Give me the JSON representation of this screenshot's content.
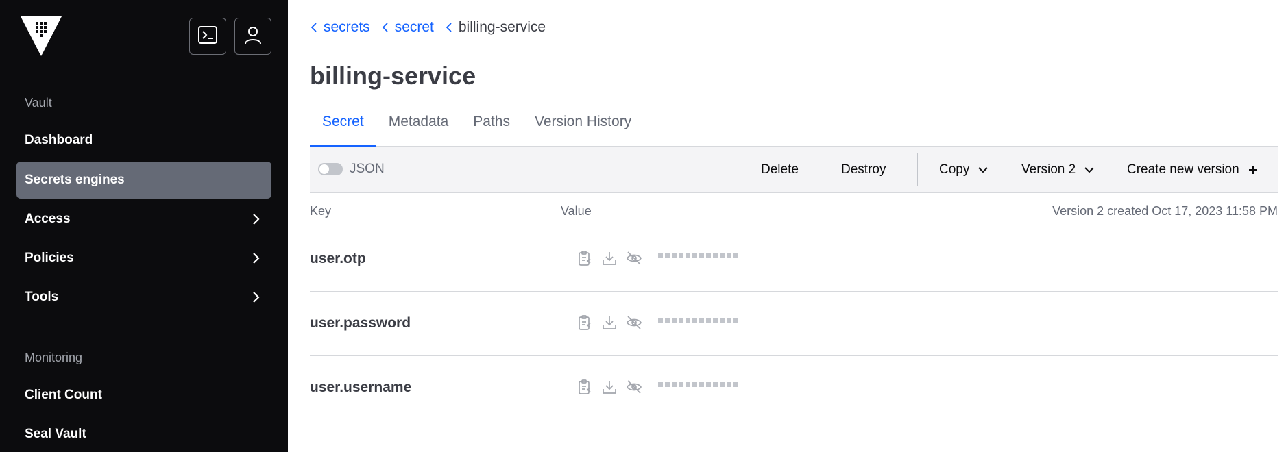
{
  "sidebar": {
    "logo_icon": "vault-logo-icon",
    "console_icon": "terminal-icon",
    "user_icon": "user-icon",
    "vault_heading": "Vault",
    "items": [
      {
        "label": "Dashboard"
      },
      {
        "label": "Secrets engines",
        "active": true
      },
      {
        "label": "Access"
      },
      {
        "label": "Policies"
      },
      {
        "label": "Tools"
      }
    ],
    "monitoring_heading": "Monitoring",
    "monitoring_items": [
      {
        "label": "Client Count"
      },
      {
        "label": "Seal Vault"
      }
    ]
  },
  "breadcrumb": {
    "items": [
      "secrets",
      "secret",
      "billing-service"
    ]
  },
  "page": {
    "title": "billing-service"
  },
  "tabs": [
    {
      "label": "Secret",
      "active": true
    },
    {
      "label": "Metadata"
    },
    {
      "label": "Paths"
    },
    {
      "label": "Version History"
    }
  ],
  "toolbar": {
    "json_label": "JSON",
    "delete_label": "Delete",
    "destroy_label": "Destroy",
    "copy_label": "Copy",
    "version_label": "Version 2",
    "create_label": "Create new version"
  },
  "table": {
    "key_header": "Key",
    "value_header": "Value",
    "version_info": "Version 2 created Oct 17, 2023 11:58 PM",
    "rows": [
      {
        "key": "user.otp"
      },
      {
        "key": "user.password"
      },
      {
        "key": "user.username"
      }
    ]
  },
  "colors": {
    "accent": "#1563ff",
    "sidebar_bg": "#0c0c0e",
    "active_nav": "#656a76"
  }
}
